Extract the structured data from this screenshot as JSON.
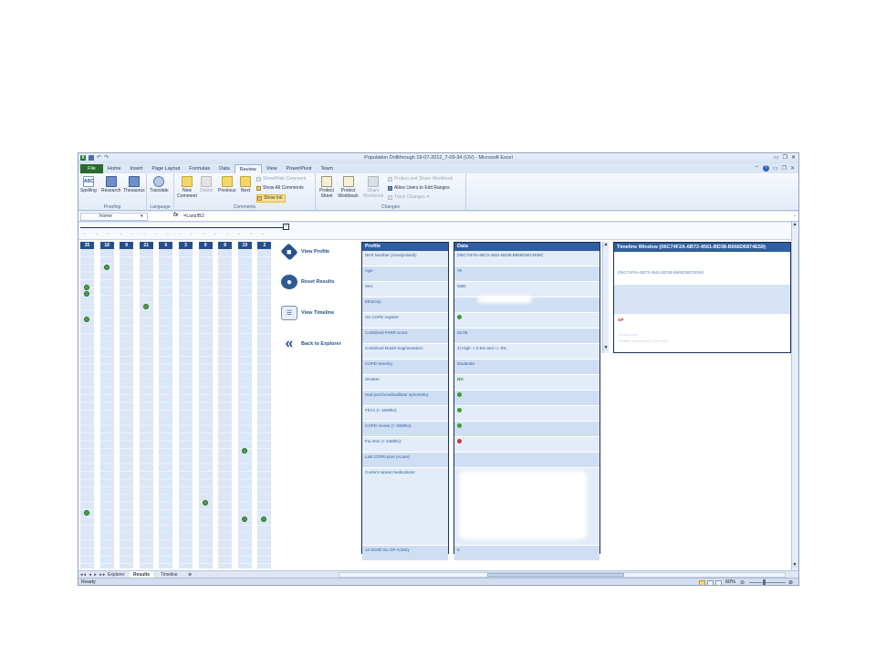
{
  "window": {
    "title": "Population Drillthrough 19-07-2012_7-09-34 (OV) - Microsoft Excel"
  },
  "ribbon_tabs": [
    "File",
    "Home",
    "Insert",
    "Page Layout",
    "Formulas",
    "Data",
    "Review",
    "View",
    "PowerPivot",
    "Team"
  ],
  "ribbon": {
    "proofing": {
      "label": "Proofing",
      "spelling": "Spelling",
      "research": "Research",
      "thesaurus": "Thesaurus"
    },
    "language": {
      "label": "Language",
      "translate": "Translate"
    },
    "comments": {
      "label": "Comments",
      "new": "New Comment",
      "delete": "Delete",
      "previous": "Previous",
      "next": "Next",
      "show_hide": "Show/Hide Comment",
      "show_all": "Show All Comments",
      "show_ink": "Show Ink"
    },
    "changes": {
      "label": "Changes",
      "protect_sheet": "Protect Sheet",
      "protect_workbook": "Protect Workbook",
      "share_workbook": "Share Workbook",
      "protect_share": "Protect and Share Workbook",
      "allow_users": "Allow Users to Edit Ranges",
      "track_changes": "Track Changes"
    }
  },
  "formula_bar": {
    "name_box": "home",
    "fx": "fx",
    "formula": "=Lists!B2"
  },
  "columns": [
    {
      "count": "35",
      "checks": [
        0.13,
        0.15,
        0.23,
        0.82
      ]
    },
    {
      "count": "18",
      "checks": [
        0.07
      ]
    },
    {
      "count": "9",
      "checks": []
    },
    {
      "count": "21",
      "checks": [
        0.19
      ]
    },
    {
      "count": "6",
      "checks": []
    },
    {
      "count": "3",
      "checks": []
    },
    {
      "count": "9",
      "checks": [
        0.79
      ]
    },
    {
      "count": "8",
      "checks": []
    },
    {
      "count": "19",
      "checks": [
        0.63,
        0.84
      ]
    },
    {
      "count": "2",
      "checks": [
        0.84
      ]
    }
  ],
  "actions": {
    "view_profile": "View Profile",
    "reset_results": "Reset Results",
    "view_timeline": "View Timeline",
    "back_to_explorer": "Back to Explorer"
  },
  "profile": {
    "header": "Profile",
    "rows": [
      "NHS Number (Anonymised):",
      "Age:",
      "Sex:",
      "Ethnicity:",
      "On COPD register:",
      "Combined PARR score:",
      "Combined Model Segmentation:",
      "COPD severity:",
      "Smoker:",
      "Had post bron/bodilator spirometry:",
      "FEV1 (< 15Mths):",
      "COPD review (< 15Mths):",
      "Flu Imm (< 12Mths):",
      "Last COPD  proc (Acute):",
      "Current repeat medications:",
      "12 Month No GP Activity"
    ]
  },
  "data_panel": {
    "header": "Data",
    "rows": [
      {
        "text": "{06C74F2A-6B72-4561-BD38-B666D6874E59}"
      },
      {
        "text": "78"
      },
      {
        "text": "Male"
      },
      {
        "text": ""
      },
      {
        "icon": "check"
      },
      {
        "text": "32.08"
      },
      {
        "text": "2) High: > 0.5% and <= 5%"
      },
      {
        "text": "Moderate"
      },
      {
        "text": "NO",
        "green": true
      },
      {
        "icon": "check"
      },
      {
        "icon": "check"
      },
      {
        "icon": "check"
      },
      {
        "icon": "cross"
      },
      {
        "text": ""
      },
      {
        "text": ""
      },
      {
        "text": "0"
      }
    ]
  },
  "timeline": {
    "header": "Timeline Window {06C74F2A-6B72-4561-BD38-B666D6874E59}",
    "id": "{06C74F2A-6B72-4561-BD38-B666D6874E59}",
    "gp_label": "GP",
    "faint1": "Clinical code",
    "faint2": "Ventolin (salbutamol) 100 mcg"
  },
  "sheet_tabs": [
    "Explorer",
    "Results",
    "Timeline"
  ],
  "active_sheet": "Results",
  "status": {
    "ready": "Ready",
    "zoom": "60%"
  },
  "colors": {
    "header_blue": "#2f5fa0",
    "panel_border": "#1a2f55",
    "row_light": "#e3ecf8",
    "row_dark": "#cfdef2",
    "check_green": "#3f9a38",
    "cross_red": "#c8372f"
  }
}
